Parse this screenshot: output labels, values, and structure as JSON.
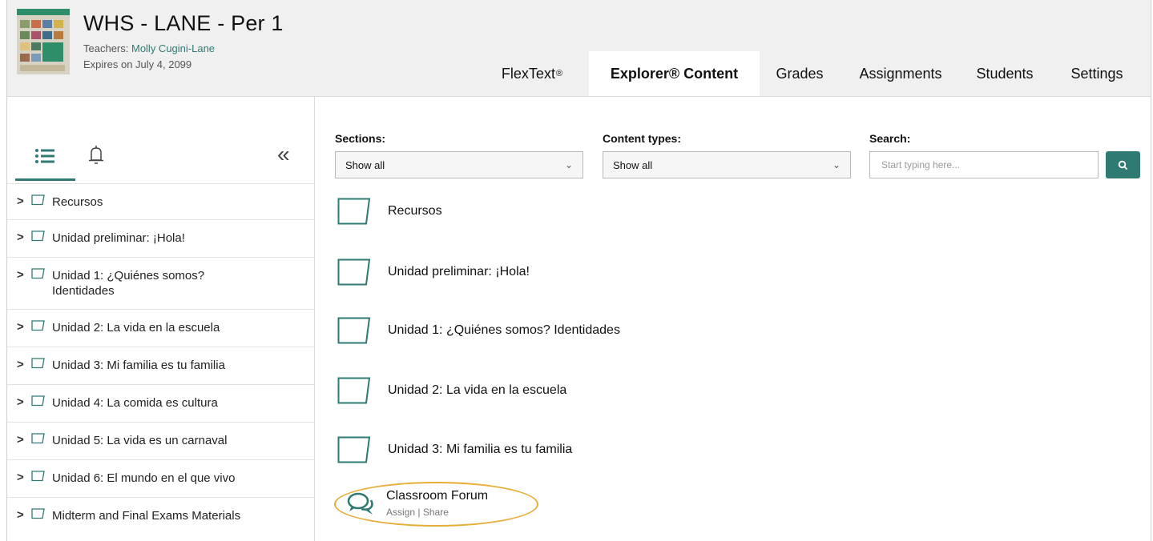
{
  "course": {
    "title": "WHS - LANE - Per 1",
    "teachers_label": "Teachers: ",
    "teacher_name": "Molly Cugini-Lane",
    "expires": "Expires on July 4, 2099"
  },
  "tabs": [
    {
      "label": "FlexText",
      "mark": "®",
      "active": false
    },
    {
      "label": "Explorer® Content",
      "active": true
    },
    {
      "label": "Grades",
      "active": false
    },
    {
      "label": "Assignments",
      "active": false
    },
    {
      "label": "Students",
      "active": false
    },
    {
      "label": "Settings",
      "active": false
    }
  ],
  "sidebar": {
    "icons": [
      "list-icon",
      "bell-icon",
      "double-chevron-left-icon"
    ],
    "collapse_glyph": "«",
    "items": [
      {
        "label": "Recursos"
      },
      {
        "label": "Unidad preliminar: ¡Hola!"
      },
      {
        "label": "Unidad 1: ¿Quiénes somos? Identidades"
      },
      {
        "label": "Unidad 2: La vida en la escuela"
      },
      {
        "label": "Unidad 3: Mi familia es tu familia"
      },
      {
        "label": "Unidad 4: La comida es cultura"
      },
      {
        "label": "Unidad 5: La vida es un carnaval"
      },
      {
        "label": "Unidad 6: El mundo en el que vivo"
      },
      {
        "label": "Midterm and Final Exams Materials"
      }
    ]
  },
  "filters": {
    "sections_label": "Sections:",
    "sections_value": "Show all",
    "content_types_label": "Content types:",
    "content_types_value": "Show all",
    "search_label": "Search:",
    "search_placeholder": "Start typing here..."
  },
  "content": [
    {
      "label": "Recursos"
    },
    {
      "label": "Unidad preliminar: ¡Hola!"
    },
    {
      "label": "Unidad 1: ¿Quiénes somos? Identidades"
    },
    {
      "label": "Unidad 2: La vida en la escuela"
    },
    {
      "label": "Unidad 3: Mi familia es tu familia"
    }
  ],
  "forum": {
    "title": "Classroom Forum",
    "assign": "Assign",
    "separator": "|",
    "share": "Share"
  },
  "colors": {
    "accent": "#2f7b74",
    "highlight": "#e7ad37",
    "header_bg": "#f0f0f0"
  }
}
